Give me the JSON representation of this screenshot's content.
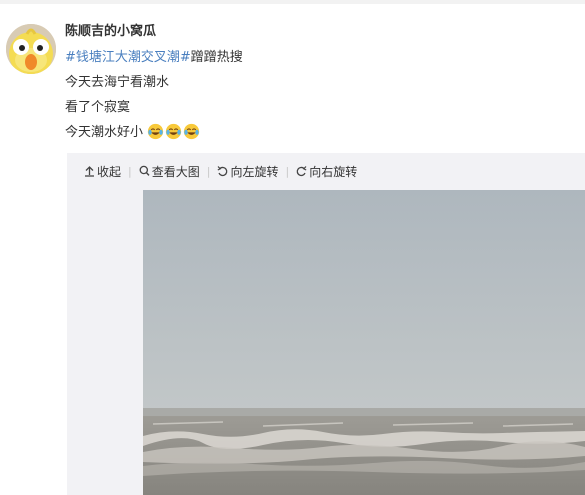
{
  "post": {
    "author": "陈顺吉的小窝瓜",
    "topic": "#钱塘江大潮交叉潮#",
    "topic_suffix": "蹭蹭热搜",
    "lines": [
      "今天去海宁看潮水",
      "看了个寂寞",
      "今天潮水好小"
    ],
    "emoji_name": "laugh-cry-emoji",
    "emoji_count": 3
  },
  "media_toolbar": {
    "collapse": "收起",
    "view_large": "查看大图",
    "rotate_left": "向左旋转",
    "rotate_right": "向右旋转"
  },
  "colors": {
    "topic_link": "#4a7fbf",
    "media_background": "#f2f2f5",
    "sky": "#b8c0c6",
    "water": "#8e8c86"
  }
}
